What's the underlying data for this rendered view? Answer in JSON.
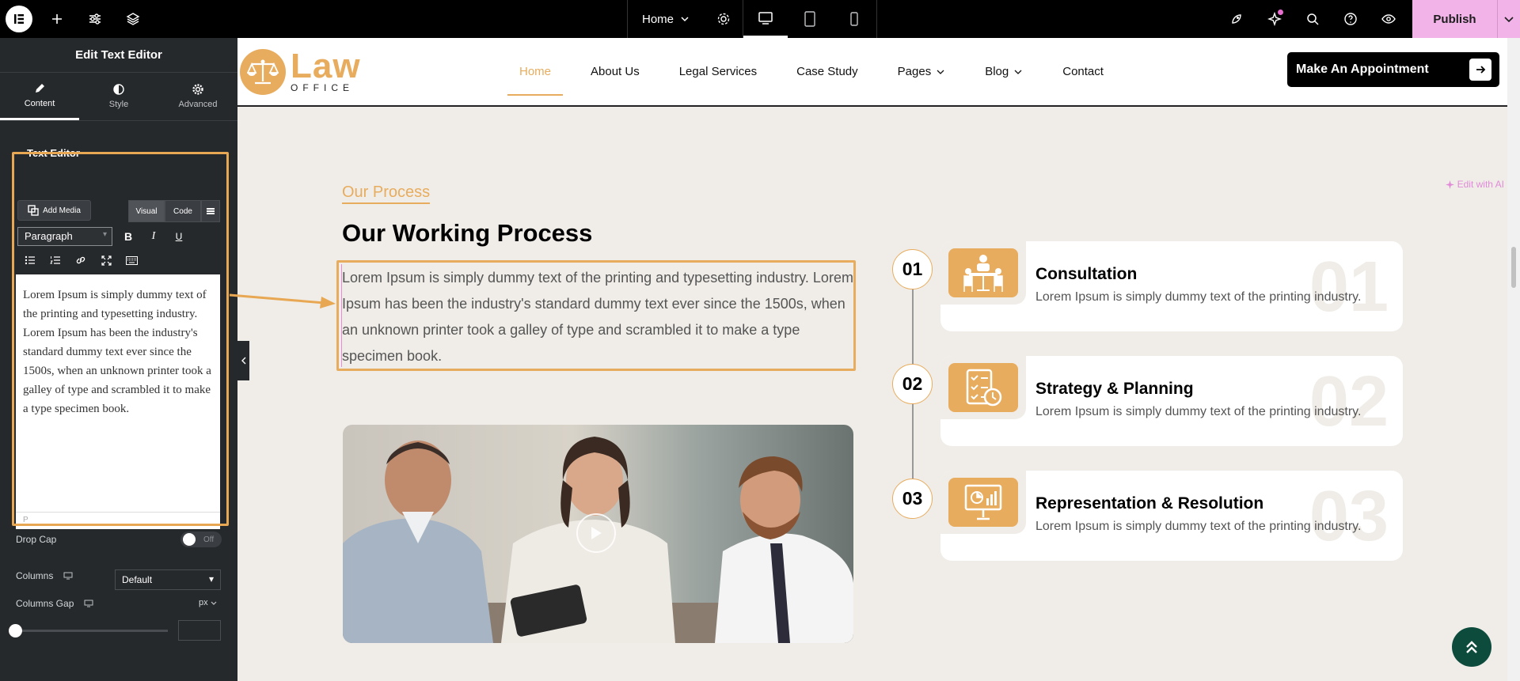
{
  "topbar": {
    "page_name": "Home",
    "publish_label": "Publish"
  },
  "panel": {
    "title": "Edit Text Editor",
    "tabs": [
      {
        "label": "Content"
      },
      {
        "label": "Style"
      },
      {
        "label": "Advanced"
      }
    ],
    "section_label": "Text Editor",
    "edit_ai_label": "Edit with AI",
    "add_media_label": "Add Media",
    "visual_label": "Visual",
    "code_label": "Code",
    "format_value": "Paragraph",
    "editor_text": "Lorem Ipsum is simply dummy text of the printing and typesetting industry. Lorem Ipsum has been the industry's standard dummy text ever since the 1500s, when an unknown printer took a galley of type and scrambled it to make a type specimen book.",
    "editor_status": "P",
    "drop_cap_label": "Drop Cap",
    "drop_cap_state": "Off",
    "columns_label": "Columns",
    "columns_value": "Default",
    "columns_gap_label": "Columns Gap",
    "columns_gap_unit": "px"
  },
  "site": {
    "logo_main": "Law",
    "logo_sub": "OFFICE",
    "nav": [
      {
        "label": "Home"
      },
      {
        "label": "About Us"
      },
      {
        "label": "Legal Services"
      },
      {
        "label": "Case Study"
      },
      {
        "label": "Pages"
      },
      {
        "label": "Blog"
      },
      {
        "label": "Contact"
      }
    ],
    "cta_label": "Make An Appointment",
    "kicker": "Our Process",
    "heading": "Our Working Process",
    "paragraph": "Lorem Ipsum is simply dummy text of the printing and typesetting industry. Lorem Ipsum has been the industry's standard dummy text ever since the 1500s, when an unknown printer took a galley of type and scrambled it to make a type specimen book.",
    "steps": [
      {
        "num": "01",
        "big": "01",
        "title": "Consultation",
        "desc": "Lorem Ipsum is simply dummy text of the printing industry."
      },
      {
        "num": "02",
        "big": "02",
        "title": "Strategy & Planning",
        "desc": "Lorem Ipsum is simply dummy text of the printing industry."
      },
      {
        "num": "03",
        "big": "03",
        "title": "Representation & Resolution",
        "desc": "Lorem Ipsum is simply dummy text of the printing industry."
      }
    ]
  },
  "colors": {
    "accent": "#e8ac5e",
    "publish": "#f1b3e8",
    "panel_bg": "#26292c",
    "scroll_top_btn": "#0d4b3c"
  }
}
